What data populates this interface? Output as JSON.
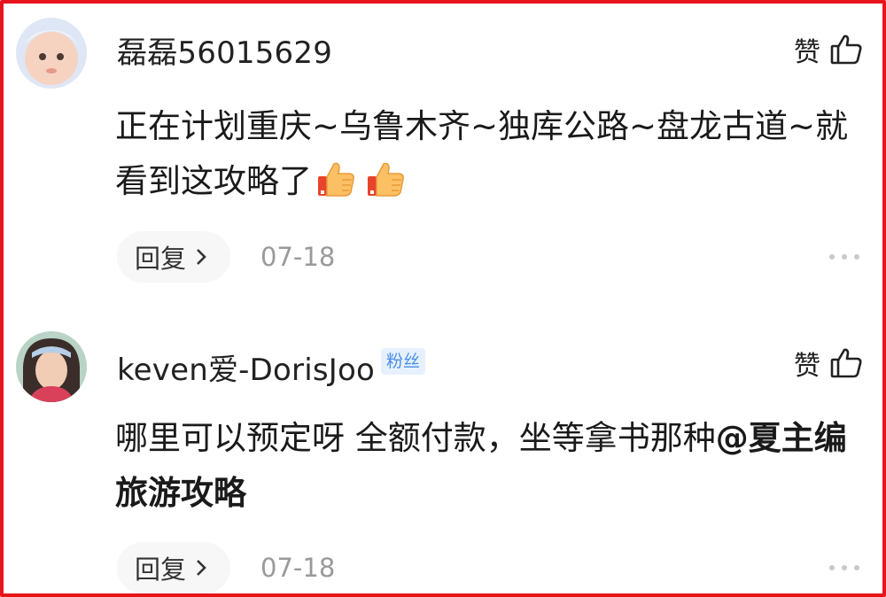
{
  "comments": [
    {
      "username": "磊磊56015629",
      "like_label": "赞",
      "content": "正在计划重庆~乌鲁木齐~独库公路~盘龙古道~就看到这攻略了",
      "emoji": [
        "thumbs-up-icon",
        "thumbs-up-icon"
      ],
      "reply_label": "回复",
      "date": "07-18"
    },
    {
      "username": "keven爱-DorisJoo",
      "badge": "粉丝",
      "like_label": "赞",
      "content": "哪里可以预定呀 全额付款，坐等拿书那种",
      "mention": "@夏主编旅游攻略",
      "reply_label": "回复",
      "date": "07-18"
    }
  ],
  "colors": {
    "frame_border": "#e8141c",
    "badge_text": "#4a8ee8",
    "badge_bg": "#e7f1fd",
    "date_text": "#999999",
    "reply_bg": "#f7f7f8"
  }
}
